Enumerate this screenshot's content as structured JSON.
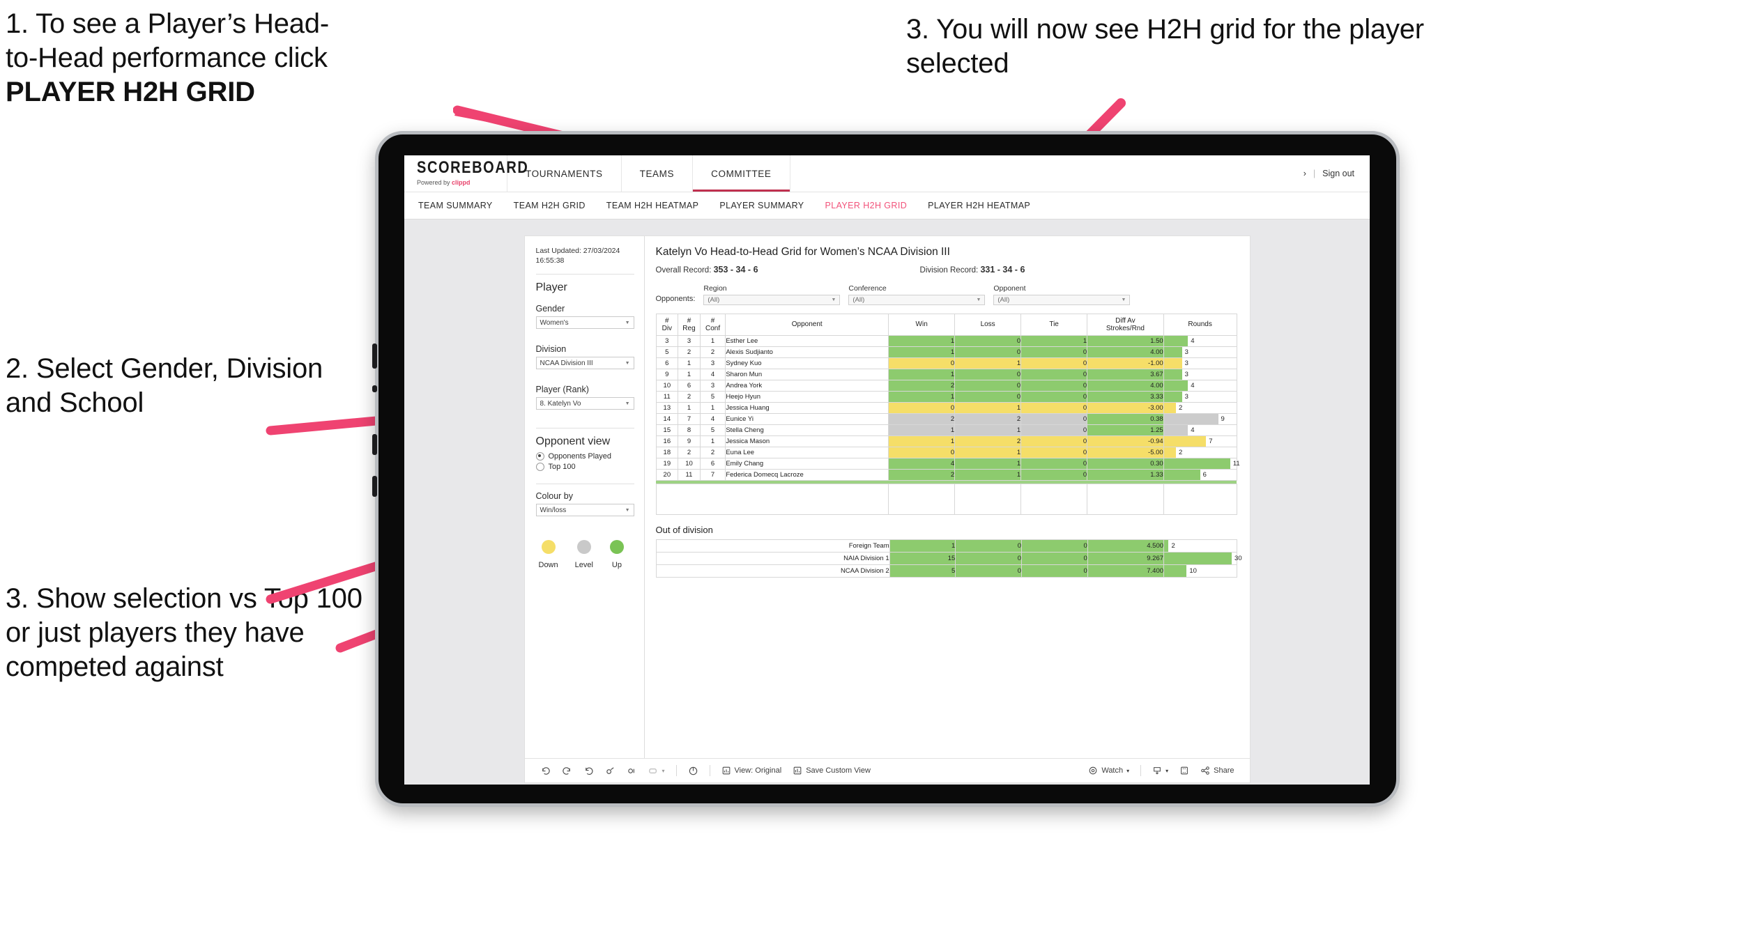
{
  "annotations": {
    "a1_line1": "1. To see a Player’s Head-",
    "a1_line2": "to-Head performance click",
    "a1_bold": "PLAYER H2H GRID",
    "a2": "2. Select Gender, Division and School",
    "a3": "3. Show selection vs Top 100 or just players they have competed against",
    "a4": "3. You will now see H2H grid for the player selected"
  },
  "colors": {
    "accent_pink": "#f2527a",
    "arrow_pink": "#ef4371",
    "win_green": "#8dcb6e",
    "loss_yellow": "#f5de68",
    "level_grey": "#cccccc",
    "brand_pink": "#e8446d"
  },
  "header": {
    "brand_title": "SCOREBOARD",
    "brand_powered": "Powered by",
    "brand_name": "clippd",
    "nav": [
      {
        "label": "TOURNAMENTS",
        "active": false
      },
      {
        "label": "TEAMS",
        "active": false
      },
      {
        "label": "COMMITTEE",
        "active": true
      }
    ],
    "user_chevron": "›",
    "separator": "|",
    "sign_out": "Sign out"
  },
  "subnav": [
    {
      "label": "TEAM SUMMARY",
      "active": false
    },
    {
      "label": "TEAM H2H GRID",
      "active": false
    },
    {
      "label": "TEAM H2H HEATMAP",
      "active": false
    },
    {
      "label": "PLAYER SUMMARY",
      "active": false
    },
    {
      "label": "PLAYER H2H GRID",
      "active": true
    },
    {
      "label": "PLAYER H2H HEATMAP",
      "active": false
    }
  ],
  "sidebar": {
    "last_updated_line1": "Last Updated: 27/03/2024",
    "last_updated_line2": "16:55:38",
    "player_section": "Player",
    "gender_label": "Gender",
    "gender_value": "Women's",
    "division_label": "Division",
    "division_value": "NCAA Division III",
    "player_rank_label": "Player (Rank)",
    "player_rank_value": "8. Katelyn Vo",
    "opponent_view_title": "Opponent view",
    "opponent_view_options": [
      {
        "label": "Opponents Played",
        "selected": true
      },
      {
        "label": "Top 100",
        "selected": false
      }
    ],
    "colour_by_label": "Colour by",
    "colour_by_value": "Win/loss",
    "legend": [
      {
        "label": "Down",
        "color": "#f5de68"
      },
      {
        "label": "Level",
        "color": "#c9c9c9"
      },
      {
        "label": "Up",
        "color": "#7ac355"
      }
    ]
  },
  "main": {
    "title": "Katelyn Vo Head-to-Head Grid for Women’s NCAA Division III",
    "overall_record_label": "Overall Record:",
    "overall_record_value": "353 -  34 - 6",
    "division_record_label": "Division Record:",
    "division_record_value": "331 -  34 - 6",
    "opponents_label": "Opponents:",
    "filters": [
      {
        "caption": "Region",
        "value": "(All)"
      },
      {
        "caption": "Conference",
        "value": "(All)"
      },
      {
        "caption": "Opponent",
        "value": "(All)"
      }
    ],
    "columns": [
      {
        "l1": "#",
        "l2": "Div"
      },
      {
        "l1": "#",
        "l2": "Reg"
      },
      {
        "l1": "#",
        "l2": "Conf"
      },
      {
        "l1": "Opponent",
        "l2": ""
      },
      {
        "l1": "Win",
        "l2": ""
      },
      {
        "l1": "Loss",
        "l2": ""
      },
      {
        "l1": "Tie",
        "l2": ""
      },
      {
        "l1": "Diff Av",
        "l2": "Strokes/Rnd"
      },
      {
        "l1": "Rounds",
        "l2": ""
      }
    ],
    "out_of_division_title": "Out of division"
  },
  "chart_data": {
    "type": "table",
    "title": "Katelyn Vo Head-to-Head Grid for Women’s NCAA Division III",
    "columns": [
      "# Div",
      "# Reg",
      "# Conf",
      "Opponent",
      "Win",
      "Loss",
      "Tie",
      "Diff Av Strokes/Rnd",
      "Rounds"
    ],
    "rounds_axis_max": 12,
    "rows": [
      {
        "div": "3",
        "reg": "3",
        "conf": "1",
        "opponent": "Esther Lee",
        "win": "1",
        "loss": "0",
        "tie": "1",
        "diff": "1.50",
        "rounds": 4,
        "state": "up"
      },
      {
        "div": "5",
        "reg": "2",
        "conf": "2",
        "opponent": "Alexis Sudjianto",
        "win": "1",
        "loss": "0",
        "tie": "0",
        "diff": "4.00",
        "rounds": 3,
        "state": "up"
      },
      {
        "div": "6",
        "reg": "1",
        "conf": "3",
        "opponent": "Sydney Kuo",
        "win": "0",
        "loss": "1",
        "tie": "0",
        "diff": "-1.00",
        "rounds": 3,
        "state": "down"
      },
      {
        "div": "9",
        "reg": "1",
        "conf": "4",
        "opponent": "Sharon Mun",
        "win": "1",
        "loss": "0",
        "tie": "0",
        "diff": "3.67",
        "rounds": 3,
        "state": "up"
      },
      {
        "div": "10",
        "reg": "6",
        "conf": "3",
        "opponent": "Andrea York",
        "win": "2",
        "loss": "0",
        "tie": "0",
        "diff": "4.00",
        "rounds": 4,
        "state": "up"
      },
      {
        "div": "11",
        "reg": "2",
        "conf": "5",
        "opponent": "Heejo Hyun",
        "win": "1",
        "loss": "0",
        "tie": "0",
        "diff": "3.33",
        "rounds": 3,
        "state": "up"
      },
      {
        "div": "13",
        "reg": "1",
        "conf": "1",
        "opponent": "Jessica Huang",
        "win": "0",
        "loss": "1",
        "tie": "0",
        "diff": "-3.00",
        "rounds": 2,
        "state": "down"
      },
      {
        "div": "14",
        "reg": "7",
        "conf": "4",
        "opponent": "Eunice Yi",
        "win": "2",
        "loss": "2",
        "tie": "0",
        "diff": "0.38",
        "rounds": 9,
        "state": "level",
        "diff_state": "up"
      },
      {
        "div": "15",
        "reg": "8",
        "conf": "5",
        "opponent": "Stella Cheng",
        "win": "1",
        "loss": "1",
        "tie": "0",
        "diff": "1.25",
        "rounds": 4,
        "state": "level",
        "diff_state": "up"
      },
      {
        "div": "16",
        "reg": "9",
        "conf": "1",
        "opponent": "Jessica Mason",
        "win": "1",
        "loss": "2",
        "tie": "0",
        "diff": "-0.94",
        "rounds": 7,
        "state": "down"
      },
      {
        "div": "18",
        "reg": "2",
        "conf": "2",
        "opponent": "Euna Lee",
        "win": "0",
        "loss": "1",
        "tie": "0",
        "diff": "-5.00",
        "rounds": 2,
        "state": "down"
      },
      {
        "div": "19",
        "reg": "10",
        "conf": "6",
        "opponent": "Emily Chang",
        "win": "4",
        "loss": "1",
        "tie": "0",
        "diff": "0.30",
        "rounds": 11,
        "state": "up"
      },
      {
        "div": "20",
        "reg": "11",
        "conf": "7",
        "opponent": "Federica Domecq Lacroze",
        "win": "2",
        "loss": "1",
        "tie": "0",
        "diff": "1.33",
        "rounds": 6,
        "state": "up"
      }
    ],
    "out_of_division": {
      "rounds_axis_max": 32,
      "rows": [
        {
          "label": "Foreign Team",
          "win": "1",
          "loss": "0",
          "tie": "0",
          "diff": "4.500",
          "rounds": 2,
          "state": "up"
        },
        {
          "label": "NAIA Division 1",
          "win": "15",
          "loss": "0",
          "tie": "0",
          "diff": "9.267",
          "rounds": 30,
          "state": "up"
        },
        {
          "label": "NCAA Division 2",
          "win": "5",
          "loss": "0",
          "tie": "0",
          "diff": "7.400",
          "rounds": 10,
          "state": "up"
        }
      ]
    }
  },
  "toolbar": {
    "view_label": "View: Original",
    "save_label": "Save Custom View",
    "watch_label": "Watch",
    "share_label": "Share",
    "caret": "▾"
  }
}
